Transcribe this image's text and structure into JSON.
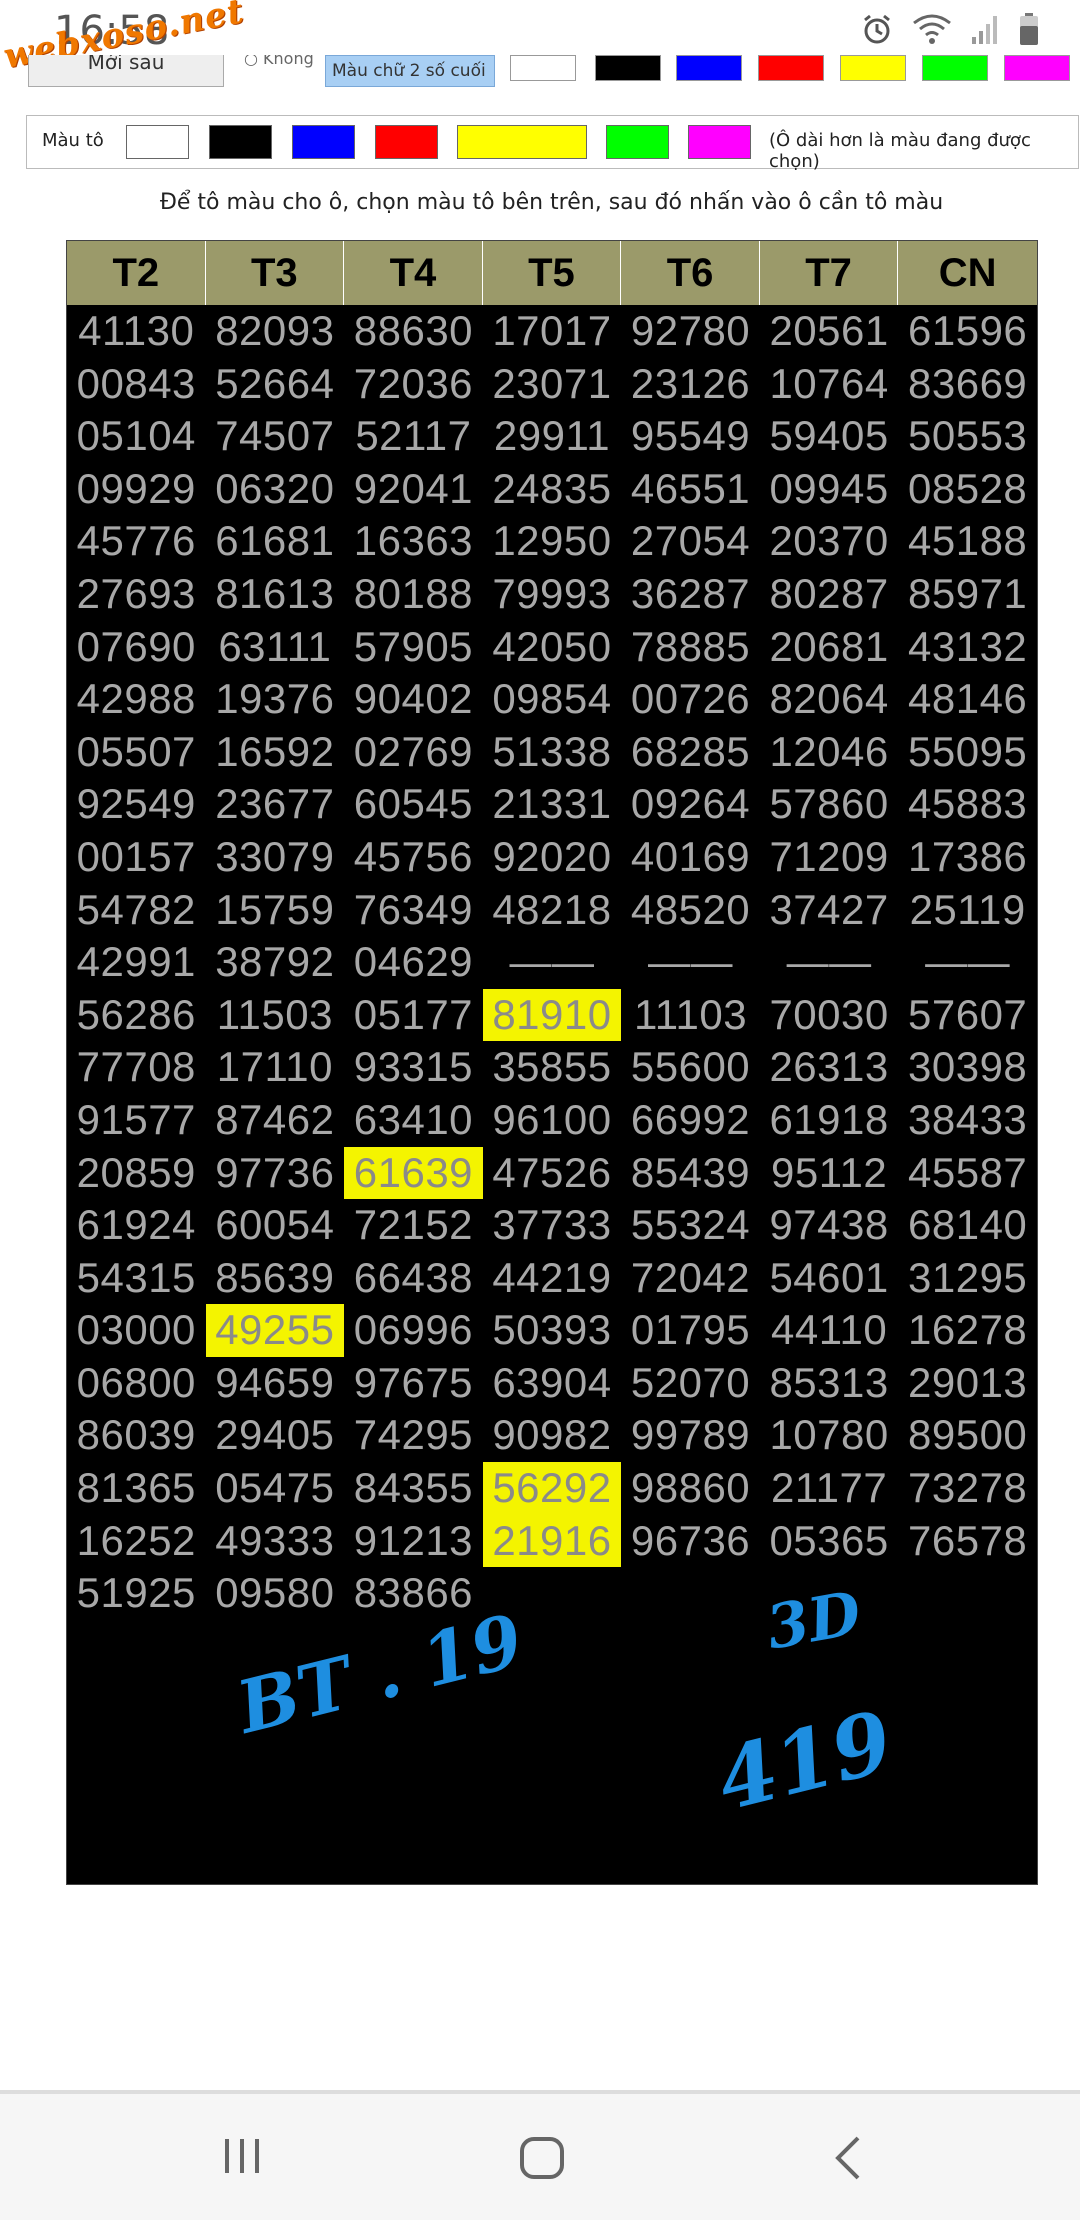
{
  "status_bar": {
    "time": "16:58",
    "logo_text": "webxoso.net"
  },
  "top_row": {
    "button_label": "Mới sau",
    "radio_label": "Không",
    "text_color_label": "Màu chữ 2 số cuối",
    "swatches": [
      "#ffffff",
      "#000000",
      "#0000ff",
      "#ff0000",
      "#ffff00",
      "#00ff00",
      "#ff00ff"
    ]
  },
  "color_row": {
    "label": "Màu tô",
    "swatches": [
      "#ffffff",
      "#000000",
      "#0000ff",
      "#ff0000",
      "#ffff00",
      "#00ff00",
      "#ff00ff"
    ],
    "selected_index": 4,
    "hint": "(Ô dài hơn là màu đang được chọn)"
  },
  "instruction": "Để tô màu cho ô, chọn màu tô bên trên, sau đó nhấn vào ô cần tô màu",
  "table": {
    "headers": [
      "T2",
      "T3",
      "T4",
      "T5",
      "T6",
      "T7",
      "CN"
    ],
    "rows": [
      [
        "41130",
        "82093",
        "88630",
        "17017",
        "92780",
        "20561",
        "61596"
      ],
      [
        "00843",
        "52664",
        "72036",
        "23071",
        "23126",
        "10764",
        "83669"
      ],
      [
        "05104",
        "74507",
        "52117",
        "29911",
        "95549",
        "59405",
        "50553"
      ],
      [
        "09929",
        "06320",
        "92041",
        "24835",
        "46551",
        "09945",
        "08528"
      ],
      [
        "45776",
        "61681",
        "16363",
        "12950",
        "27054",
        "20370",
        "45188"
      ],
      [
        "27693",
        "81613",
        "80188",
        "79993",
        "36287",
        "80287",
        "85971"
      ],
      [
        "07690",
        "63111",
        "57905",
        "42050",
        "78885",
        "20681",
        "43132"
      ],
      [
        "42988",
        "19376",
        "90402",
        "09854",
        "00726",
        "82064",
        "48146"
      ],
      [
        "05507",
        "16592",
        "02769",
        "51338",
        "68285",
        "12046",
        "55095"
      ],
      [
        "92549",
        "23677",
        "60545",
        "21331",
        "09264",
        "57860",
        "45883"
      ],
      [
        "00157",
        "33079",
        "45756",
        "92020",
        "40169",
        "71209",
        "17386"
      ],
      [
        "54782",
        "15759",
        "76349",
        "48218",
        "48520",
        "37427",
        "25119"
      ],
      [
        "42991",
        "38792",
        "04629",
        "——",
        "——",
        "——",
        "——"
      ],
      [
        "56286",
        "11503",
        "05177",
        "81910",
        "11103",
        "70030",
        "57607"
      ],
      [
        "77708",
        "17110",
        "93315",
        "35855",
        "55600",
        "26313",
        "30398"
      ],
      [
        "91577",
        "87462",
        "63410",
        "96100",
        "66992",
        "61918",
        "38433"
      ],
      [
        "20859",
        "97736",
        "61639",
        "47526",
        "85439",
        "95112",
        "45587"
      ],
      [
        "61924",
        "60054",
        "72152",
        "37733",
        "55324",
        "97438",
        "68140"
      ],
      [
        "54315",
        "85639",
        "66438",
        "44219",
        "72042",
        "54601",
        "31295"
      ],
      [
        "03000",
        "49255",
        "06996",
        "50393",
        "01795",
        "44110",
        "16278"
      ],
      [
        "06800",
        "94659",
        "97675",
        "63904",
        "52070",
        "85313",
        "29013"
      ],
      [
        "86039",
        "29405",
        "74295",
        "90982",
        "99789",
        "10780",
        "89500"
      ],
      [
        "81365",
        "05475",
        "84355",
        "56292",
        "98860",
        "21177",
        "73278"
      ],
      [
        "16252",
        "49333",
        "91213",
        "21916",
        "96736",
        "05365",
        "76578"
      ],
      [
        "51925",
        "09580",
        "83866",
        "",
        "",
        "",
        ""
      ]
    ],
    "highlight_color": "#f4f400",
    "highlighted_cells": [
      [
        13,
        3
      ],
      [
        16,
        2
      ],
      [
        19,
        1
      ],
      [
        22,
        3
      ],
      [
        23,
        3
      ]
    ]
  },
  "handwriting": {
    "note_1": "BT . 19",
    "note_2": "3D",
    "note_3": "419"
  },
  "nav_bar": {
    "recent_icon": "recent-apps-icon",
    "home_icon": "home-icon",
    "back_icon": "back-icon"
  }
}
